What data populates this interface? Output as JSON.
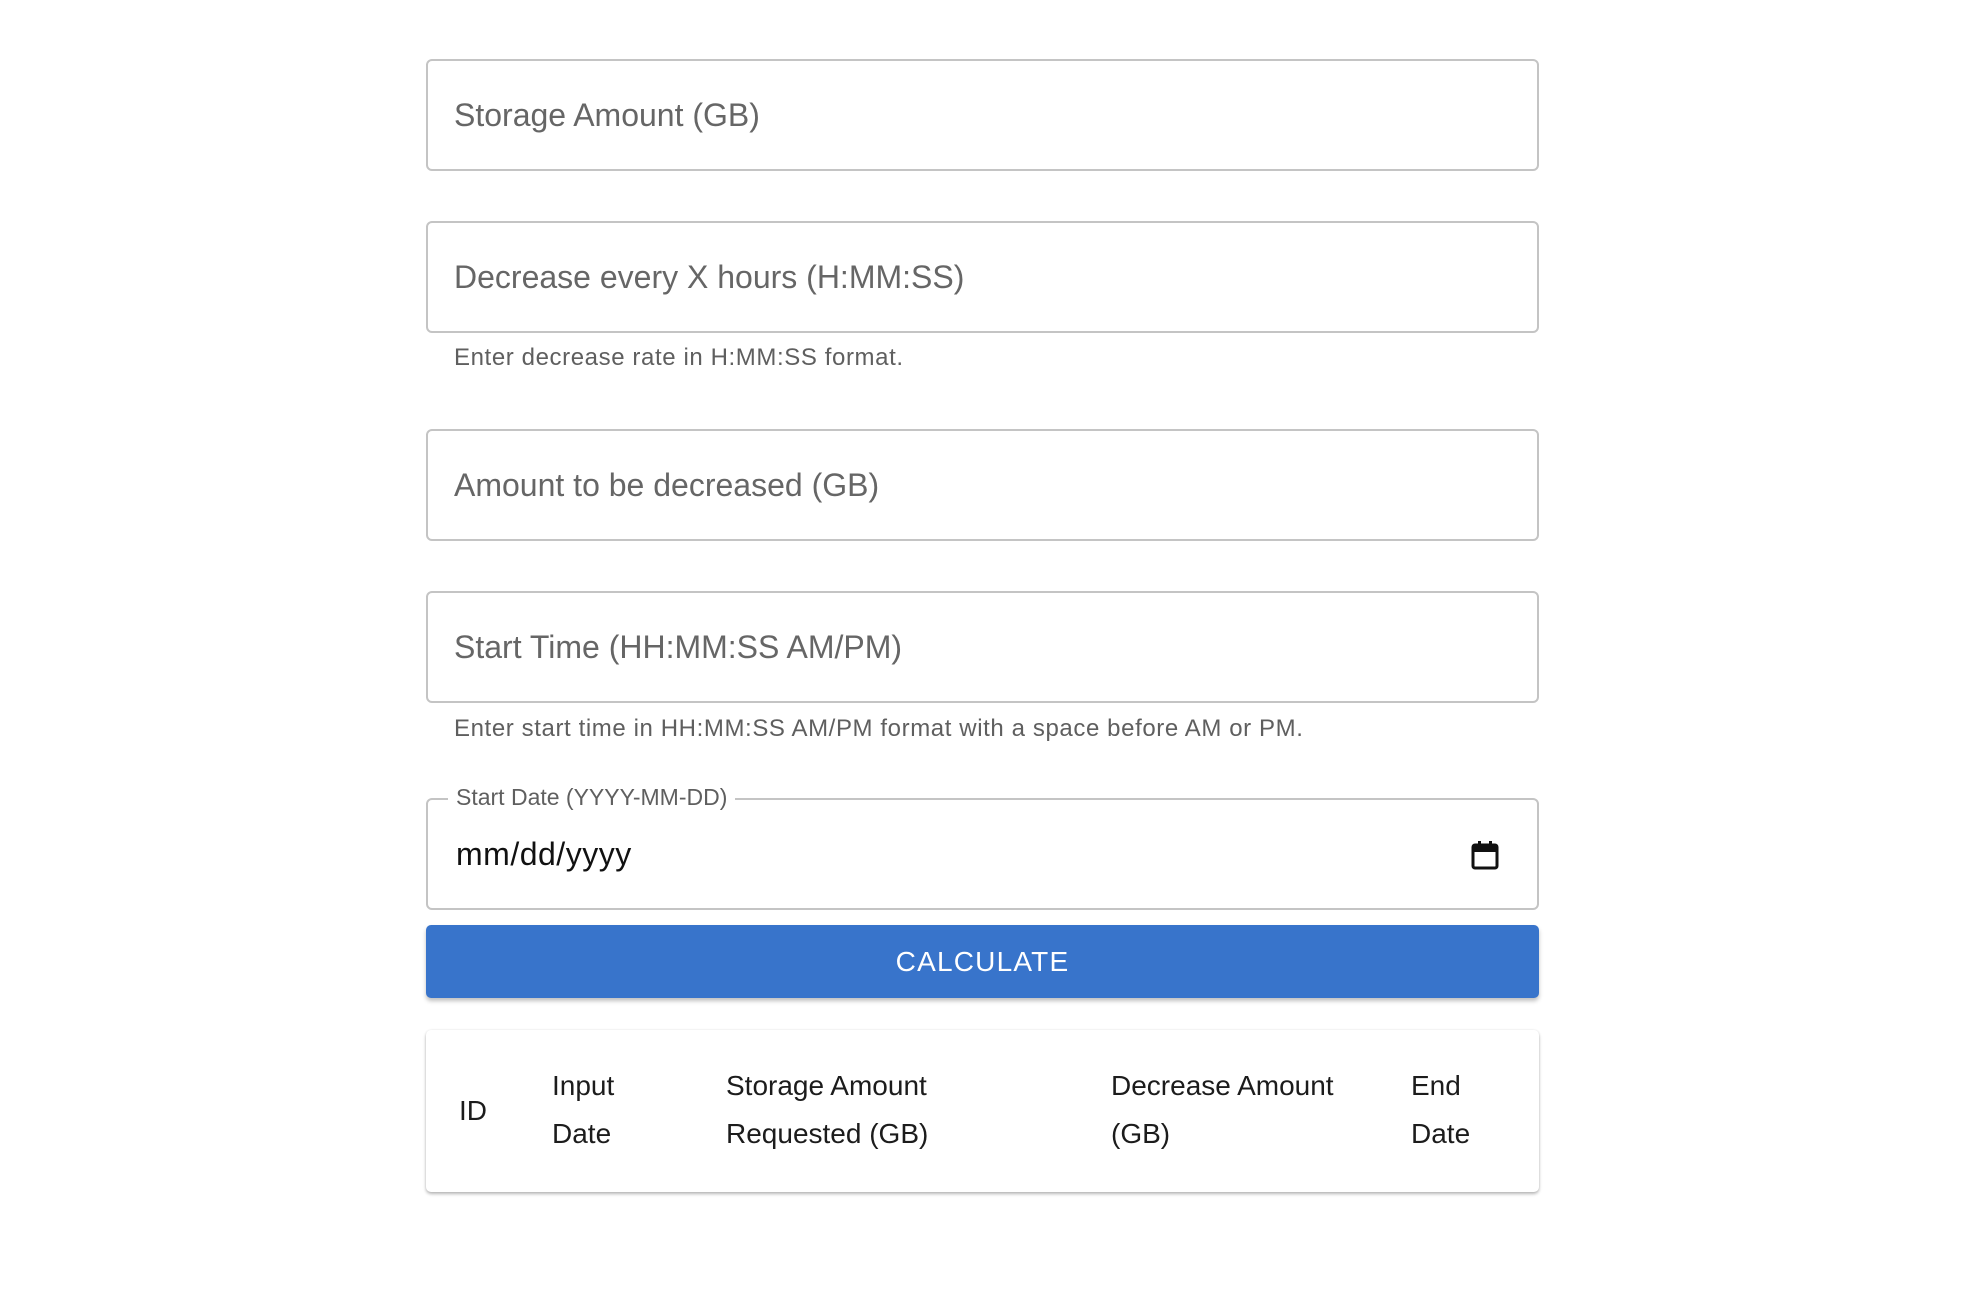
{
  "form": {
    "storage_amount": {
      "placeholder": "Storage Amount (GB)",
      "value": ""
    },
    "decrease_interval": {
      "placeholder": "Decrease every X hours (H:MM:SS)",
      "value": "",
      "helper": "Enter decrease rate in H:MM:SS format."
    },
    "decrease_amount": {
      "placeholder": "Amount to be decreased (GB)",
      "value": ""
    },
    "start_time": {
      "placeholder": "Start Time (HH:MM:SS AM/PM)",
      "value": "",
      "helper": "Enter start time in HH:MM:SS AM/PM format with a space before AM or PM."
    },
    "start_date": {
      "label": "Start Date (YYYY-MM-DD)",
      "display_value": "mm/dd/yyyy",
      "icon": "calendar-icon"
    },
    "calculate_label": "CALCULATE"
  },
  "table": {
    "headers": [
      {
        "line1": "ID",
        "line2": ""
      },
      {
        "line1": "Input",
        "line2": "Date"
      },
      {
        "line1": "Storage Amount",
        "line2": "Requested (GB)"
      },
      {
        "line1": "Decrease Amount",
        "line2": "(GB)"
      },
      {
        "line1": "End",
        "line2": "Date"
      }
    ],
    "rows": []
  },
  "colors": {
    "primary": "#3874cb",
    "border": "#c4c4c4",
    "placeholder": "#666666",
    "helper_text": "#5f5f5f"
  }
}
